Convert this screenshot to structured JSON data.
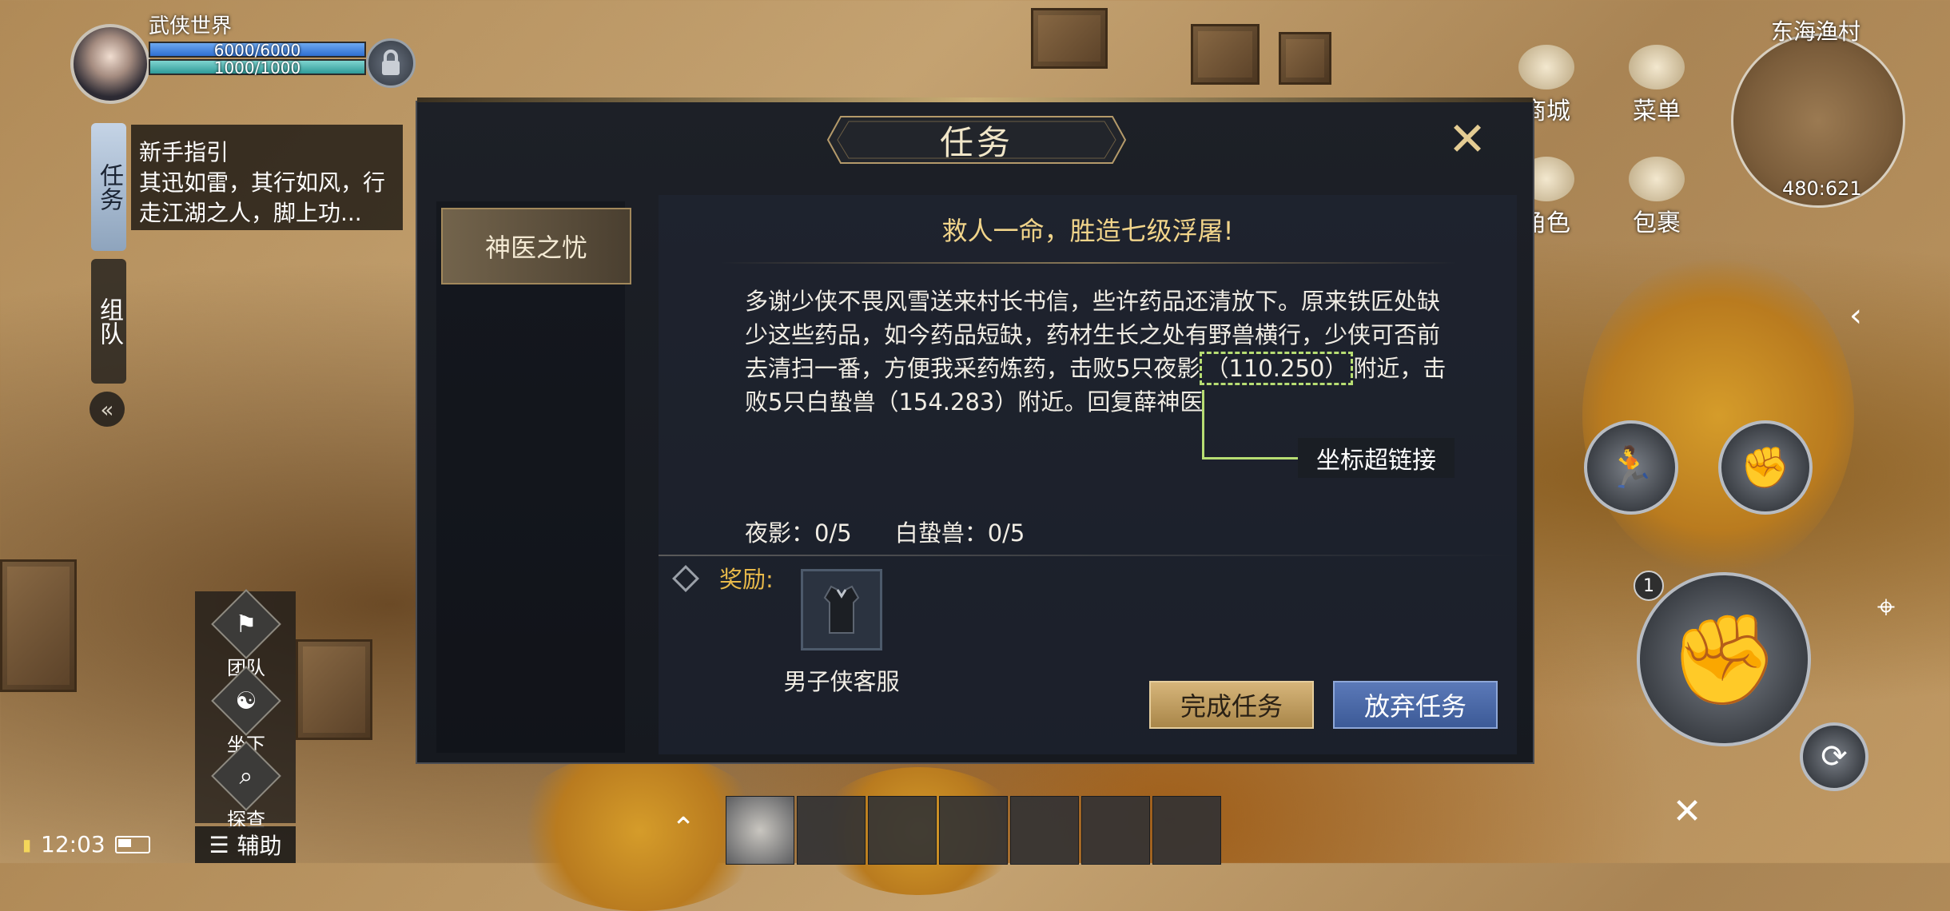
{
  "player": {
    "name": "武侠世界",
    "hp": "6000/6000",
    "mp": "1000/1000",
    "hp_fraction": 1,
    "mp_fraction": 1
  },
  "quest_tracker": {
    "tab_task": "任务",
    "tab_team": "组队",
    "title": "新手指引",
    "desc": "其迅如雷，其行如风，行走江湖之人，脚上功..."
  },
  "left_actions": {
    "team": "团队",
    "mount": "坐下",
    "explore": "探查",
    "assist": "辅助"
  },
  "status": {
    "time": "12:03"
  },
  "top_right": {
    "shop": "商城",
    "menu": "菜单",
    "character": "角色",
    "bag": "包裹",
    "map_name": "东海渔村",
    "coords": "480:621"
  },
  "skills": {
    "badge": "1"
  },
  "dialog": {
    "title": "任务",
    "quest_item": "神医之忧",
    "headline": "救人一命，胜造七级浮屠!",
    "body_before": "多谢少侠不畏风雪送来村长书信，些许药品还清放下。原来铁匠处缺少这些药品，如今药品短缺，药材生长之处有野兽横行，少侠可否前去清扫一番，方便我采药炼药，击败5只夜影",
    "coord_link": "（110.250）",
    "body_after": "附近，击败5只白蛰兽（154.283）附近。回复薛神医",
    "annotation": "坐标超链接",
    "progress": [
      "夜影：0/5",
      "白蛰兽：0/5"
    ],
    "reward_label": "奖励:",
    "reward_name": "男子侠客服",
    "btn_complete": "完成任务",
    "btn_abandon": "放弃任务"
  },
  "colors": {
    "accent_gold": "#e8b94a",
    "headline": "#f1d48a",
    "link_green": "#b7dd73",
    "abandon_blue": "#3c5a97"
  }
}
